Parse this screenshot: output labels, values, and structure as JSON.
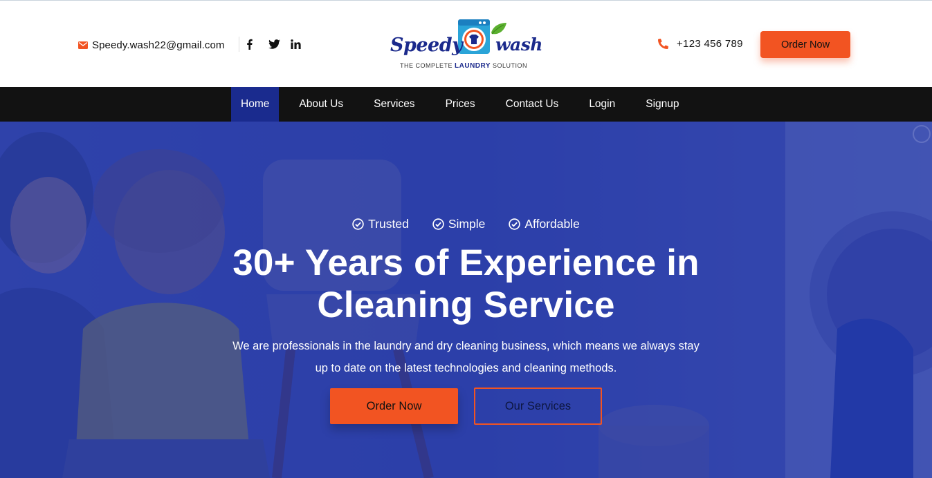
{
  "header": {
    "email": "Speedy.wash22@gmail.com",
    "social": [
      "facebook-icon",
      "twitter-icon",
      "linkedin-icon"
    ],
    "logo": {
      "word1": "Speedy",
      "word2": "wash",
      "tagline_pre": "THE COMPLETE ",
      "tagline_bold": "LAUNDRY",
      "tagline_post": " SOLUTION"
    },
    "phone": "+123 456 789",
    "order_label": "Order Now"
  },
  "nav": {
    "items": [
      {
        "label": "Home",
        "active": true
      },
      {
        "label": "About Us"
      },
      {
        "label": "Services"
      },
      {
        "label": "Prices"
      },
      {
        "label": "Contact Us"
      },
      {
        "label": "Login"
      },
      {
        "label": "Signup"
      }
    ]
  },
  "hero": {
    "badges": [
      "Trusted",
      "Simple",
      "Affordable"
    ],
    "title_line1": "30+ Years of Experience in",
    "title_line2": "Cleaning Service",
    "sub_line1": "We are professionals in the laundry and dry cleaning business, which means we always stay",
    "sub_line2": "up to date on the latest technologies and cleaning methods.",
    "primary_label": "Order Now",
    "secondary_label": "Our Services"
  },
  "colors": {
    "accent": "#f25422",
    "brand": "#1b2a8c",
    "nav_bg": "#121212",
    "nav_active": "#1a2b8e",
    "hero_overlay": "#2f43a8"
  }
}
